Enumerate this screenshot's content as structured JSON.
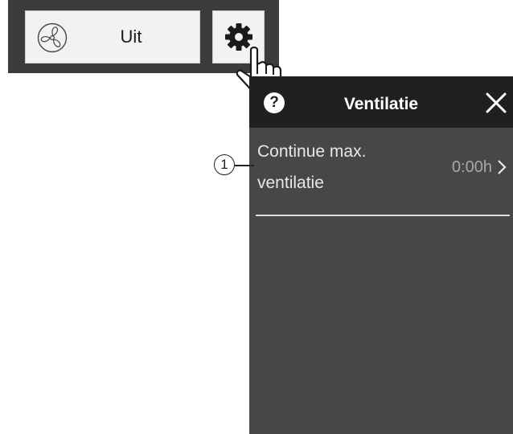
{
  "toolbar": {
    "mode_label": "Uit",
    "mode_icon": "fan-icon",
    "settings_icon": "gear-icon",
    "pointer_icon": "hand-pointer-icon"
  },
  "panel": {
    "help_label": "?",
    "title": "Ventilatie",
    "close_icon": "close-icon",
    "items": [
      {
        "label": "Continue max. ventilatie",
        "value": "0:00h"
      }
    ]
  },
  "callout": {
    "number": "1"
  },
  "colors": {
    "panel_bg": "#474747",
    "header_bg": "#202020",
    "toolbar_bg": "#3c3c3c",
    "button_bg": "#f2f2f2",
    "value_text": "#a8a8a8"
  }
}
